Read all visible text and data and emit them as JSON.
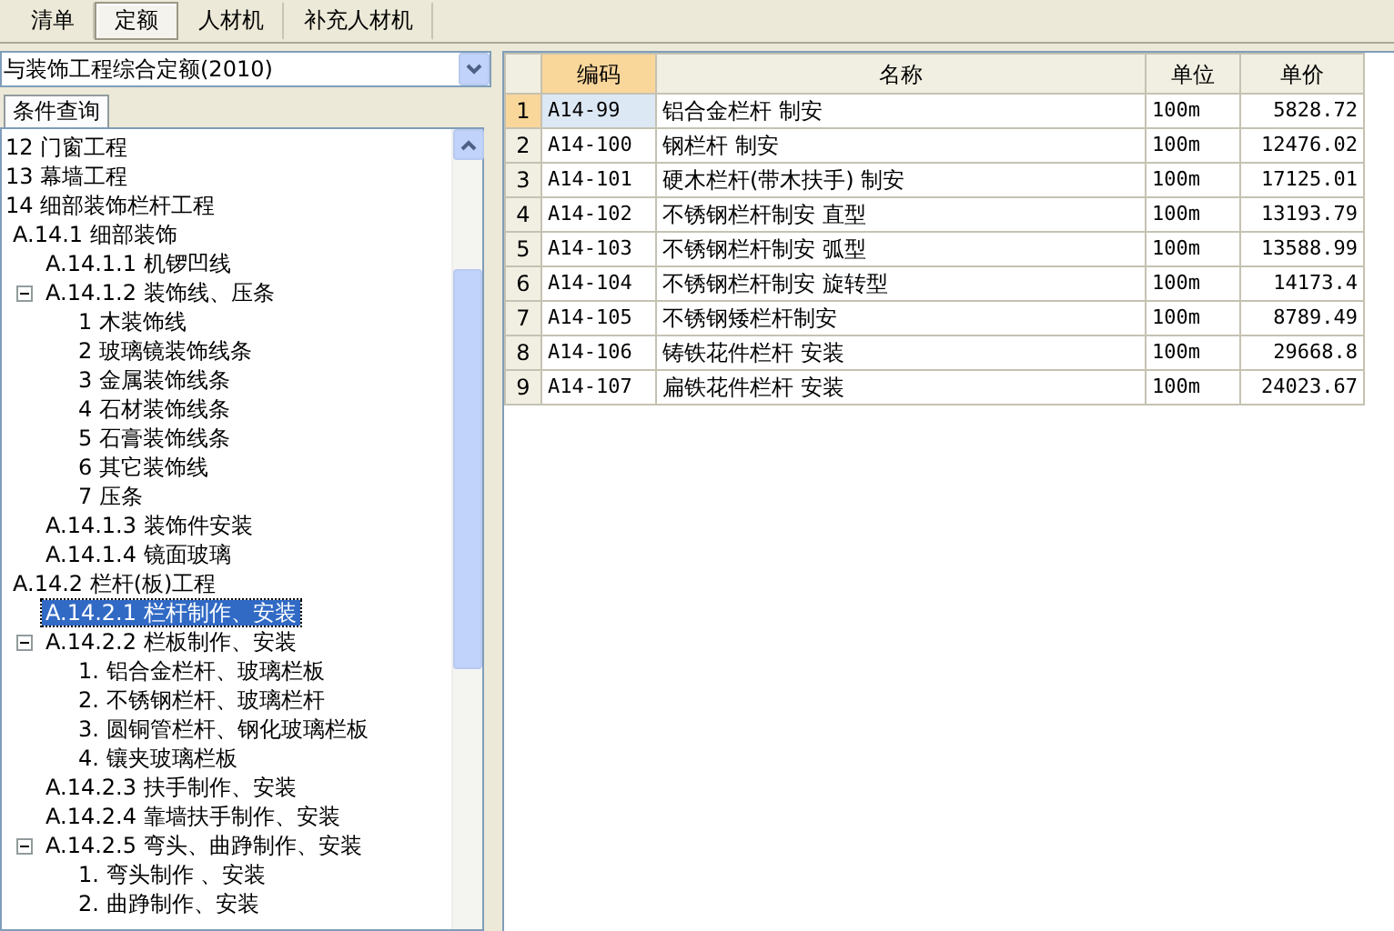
{
  "tabs": [
    {
      "label": "清单",
      "selected": false
    },
    {
      "label": "定额",
      "selected": true
    },
    {
      "label": "人材机",
      "selected": false
    },
    {
      "label": "补充人材机",
      "selected": false
    }
  ],
  "library_select": {
    "value": "与装饰工程综合定额(2010)"
  },
  "query_tab": {
    "label": "条件查询"
  },
  "tree": [
    {
      "label": "12 门窗工程",
      "selected": false
    },
    {
      "label": "13 幕墙工程",
      "selected": false
    },
    {
      "label": "14 细部装饰栏杆工程",
      "selected": false,
      "children": [
        {
          "label": "A.14.1 细部装饰",
          "selected": false,
          "children": [
            {
              "label": "A.14.1.1 机锣凹线",
              "selected": false
            },
            {
              "label": "A.14.1.2 装饰线、压条",
              "selected": false,
              "expanded": true,
              "children": [
                {
                  "label": "1 木装饰线",
                  "selected": false
                },
                {
                  "label": "2 玻璃镜装饰线条",
                  "selected": false
                },
                {
                  "label": "3 金属装饰线条",
                  "selected": false
                },
                {
                  "label": "4 石材装饰线条",
                  "selected": false
                },
                {
                  "label": "5 石膏装饰线条",
                  "selected": false
                },
                {
                  "label": "6 其它装饰线",
                  "selected": false
                },
                {
                  "label": "7 压条",
                  "selected": false
                }
              ]
            },
            {
              "label": "A.14.1.3 装饰件安装",
              "selected": false
            },
            {
              "label": "A.14.1.4 镜面玻璃",
              "selected": false
            }
          ]
        },
        {
          "label": "A.14.2 栏杆(板)工程",
          "selected": false,
          "children": [
            {
              "label": "A.14.2.1 栏杆制作、安装",
              "selected": true
            },
            {
              "label": "A.14.2.2 栏板制作、安装",
              "selected": false,
              "expanded": true,
              "children": [
                {
                  "label": "1. 铝合金栏杆、玻璃栏板",
                  "selected": false
                },
                {
                  "label": "2. 不锈钢栏杆、玻璃栏杆",
                  "selected": false
                },
                {
                  "label": "3. 圆铜管栏杆、钢化玻璃栏板",
                  "selected": false
                },
                {
                  "label": "4. 镶夹玻璃栏板",
                  "selected": false
                }
              ]
            },
            {
              "label": "A.14.2.3 扶手制作、安装",
              "selected": false
            },
            {
              "label": "A.14.2.4 靠墙扶手制作、安装",
              "selected": false
            },
            {
              "label": "A.14.2.5 弯头、曲踭制作、安装",
              "selected": false,
              "expanded": true,
              "children": [
                {
                  "label": "1. 弯头制作 、安装",
                  "selected": false
                },
                {
                  "label": "2. 曲踭制作、安装",
                  "selected": false
                }
              ]
            }
          ]
        }
      ]
    }
  ],
  "table": {
    "columns": [
      "编码",
      "名称",
      "单位",
      "单价"
    ],
    "rows": [
      {
        "number": "1",
        "code": "A14-99",
        "name": "铝合金栏杆 制安",
        "unit": "100m",
        "price": "5828.72",
        "selected": true
      },
      {
        "number": "2",
        "code": "A14-100",
        "name": "钢栏杆 制安",
        "unit": "100m",
        "price": "12476.02",
        "selected": false
      },
      {
        "number": "3",
        "code": "A14-101",
        "name": "硬木栏杆(带木扶手) 制安",
        "unit": "100m",
        "price": "17125.01",
        "selected": false
      },
      {
        "number": "4",
        "code": "A14-102",
        "name": "不锈钢栏杆制安 直型",
        "unit": "100m",
        "price": "13193.79",
        "selected": false
      },
      {
        "number": "5",
        "code": "A14-103",
        "name": "不锈钢栏杆制安 弧型",
        "unit": "100m",
        "price": "13588.99",
        "selected": false
      },
      {
        "number": "6",
        "code": "A14-104",
        "name": "不锈钢栏杆制安 旋转型",
        "unit": "100m",
        "price": "14173.4",
        "selected": false
      },
      {
        "number": "7",
        "code": "A14-105",
        "name": "不锈钢矮栏杆制安",
        "unit": "100m",
        "price": "8789.49",
        "selected": false
      },
      {
        "number": "8",
        "code": "A14-106",
        "name": "铸铁花件栏杆 安装",
        "unit": "100m",
        "price": "29668.8",
        "selected": false
      },
      {
        "number": "9",
        "code": "A14-107",
        "name": "扁铁花件栏杆 安装",
        "unit": "100m",
        "price": "24023.67",
        "selected": false
      }
    ]
  }
}
